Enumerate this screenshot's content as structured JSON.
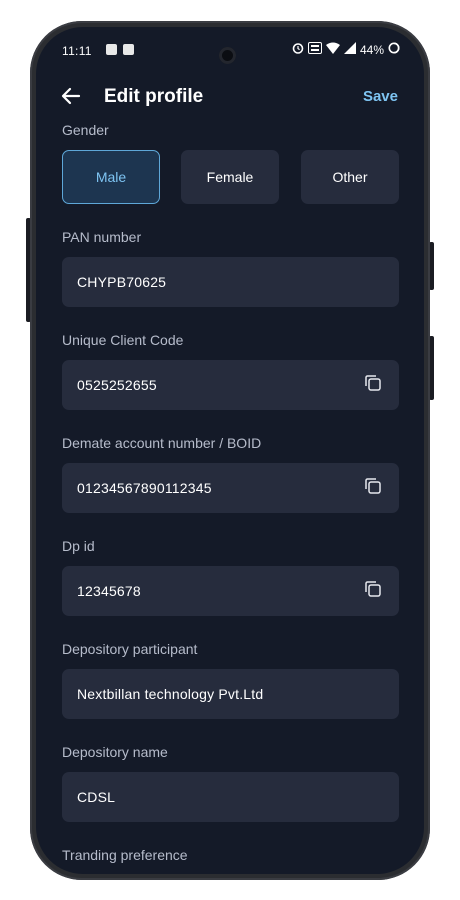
{
  "status_bar": {
    "time": "11:11",
    "battery": "44%"
  },
  "header": {
    "title": "Edit profile",
    "save_label": "Save"
  },
  "gender": {
    "label": "Gender",
    "options": [
      "Male",
      "Female",
      "Other"
    ],
    "selected": "Male"
  },
  "fields": {
    "pan": {
      "label": "PAN number",
      "value": "CHYPB70625"
    },
    "ucc": {
      "label": "Unique Client Code",
      "value": "0525252655"
    },
    "boid": {
      "label": "Demate account number / BOID",
      "value": "01234567890112345"
    },
    "dp_id": {
      "label": "Dp id",
      "value": "12345678"
    },
    "dp_participant": {
      "label": "Depository participant",
      "value": "Nextbillan technology Pvt.Ltd"
    },
    "dp_name": {
      "label": "Depository name",
      "value": "CDSL"
    }
  },
  "trading_pref": {
    "label": "Tranding preference"
  },
  "colors": {
    "background": "#141a28",
    "field": "#262c3d",
    "accent": "#7ec4f2"
  }
}
